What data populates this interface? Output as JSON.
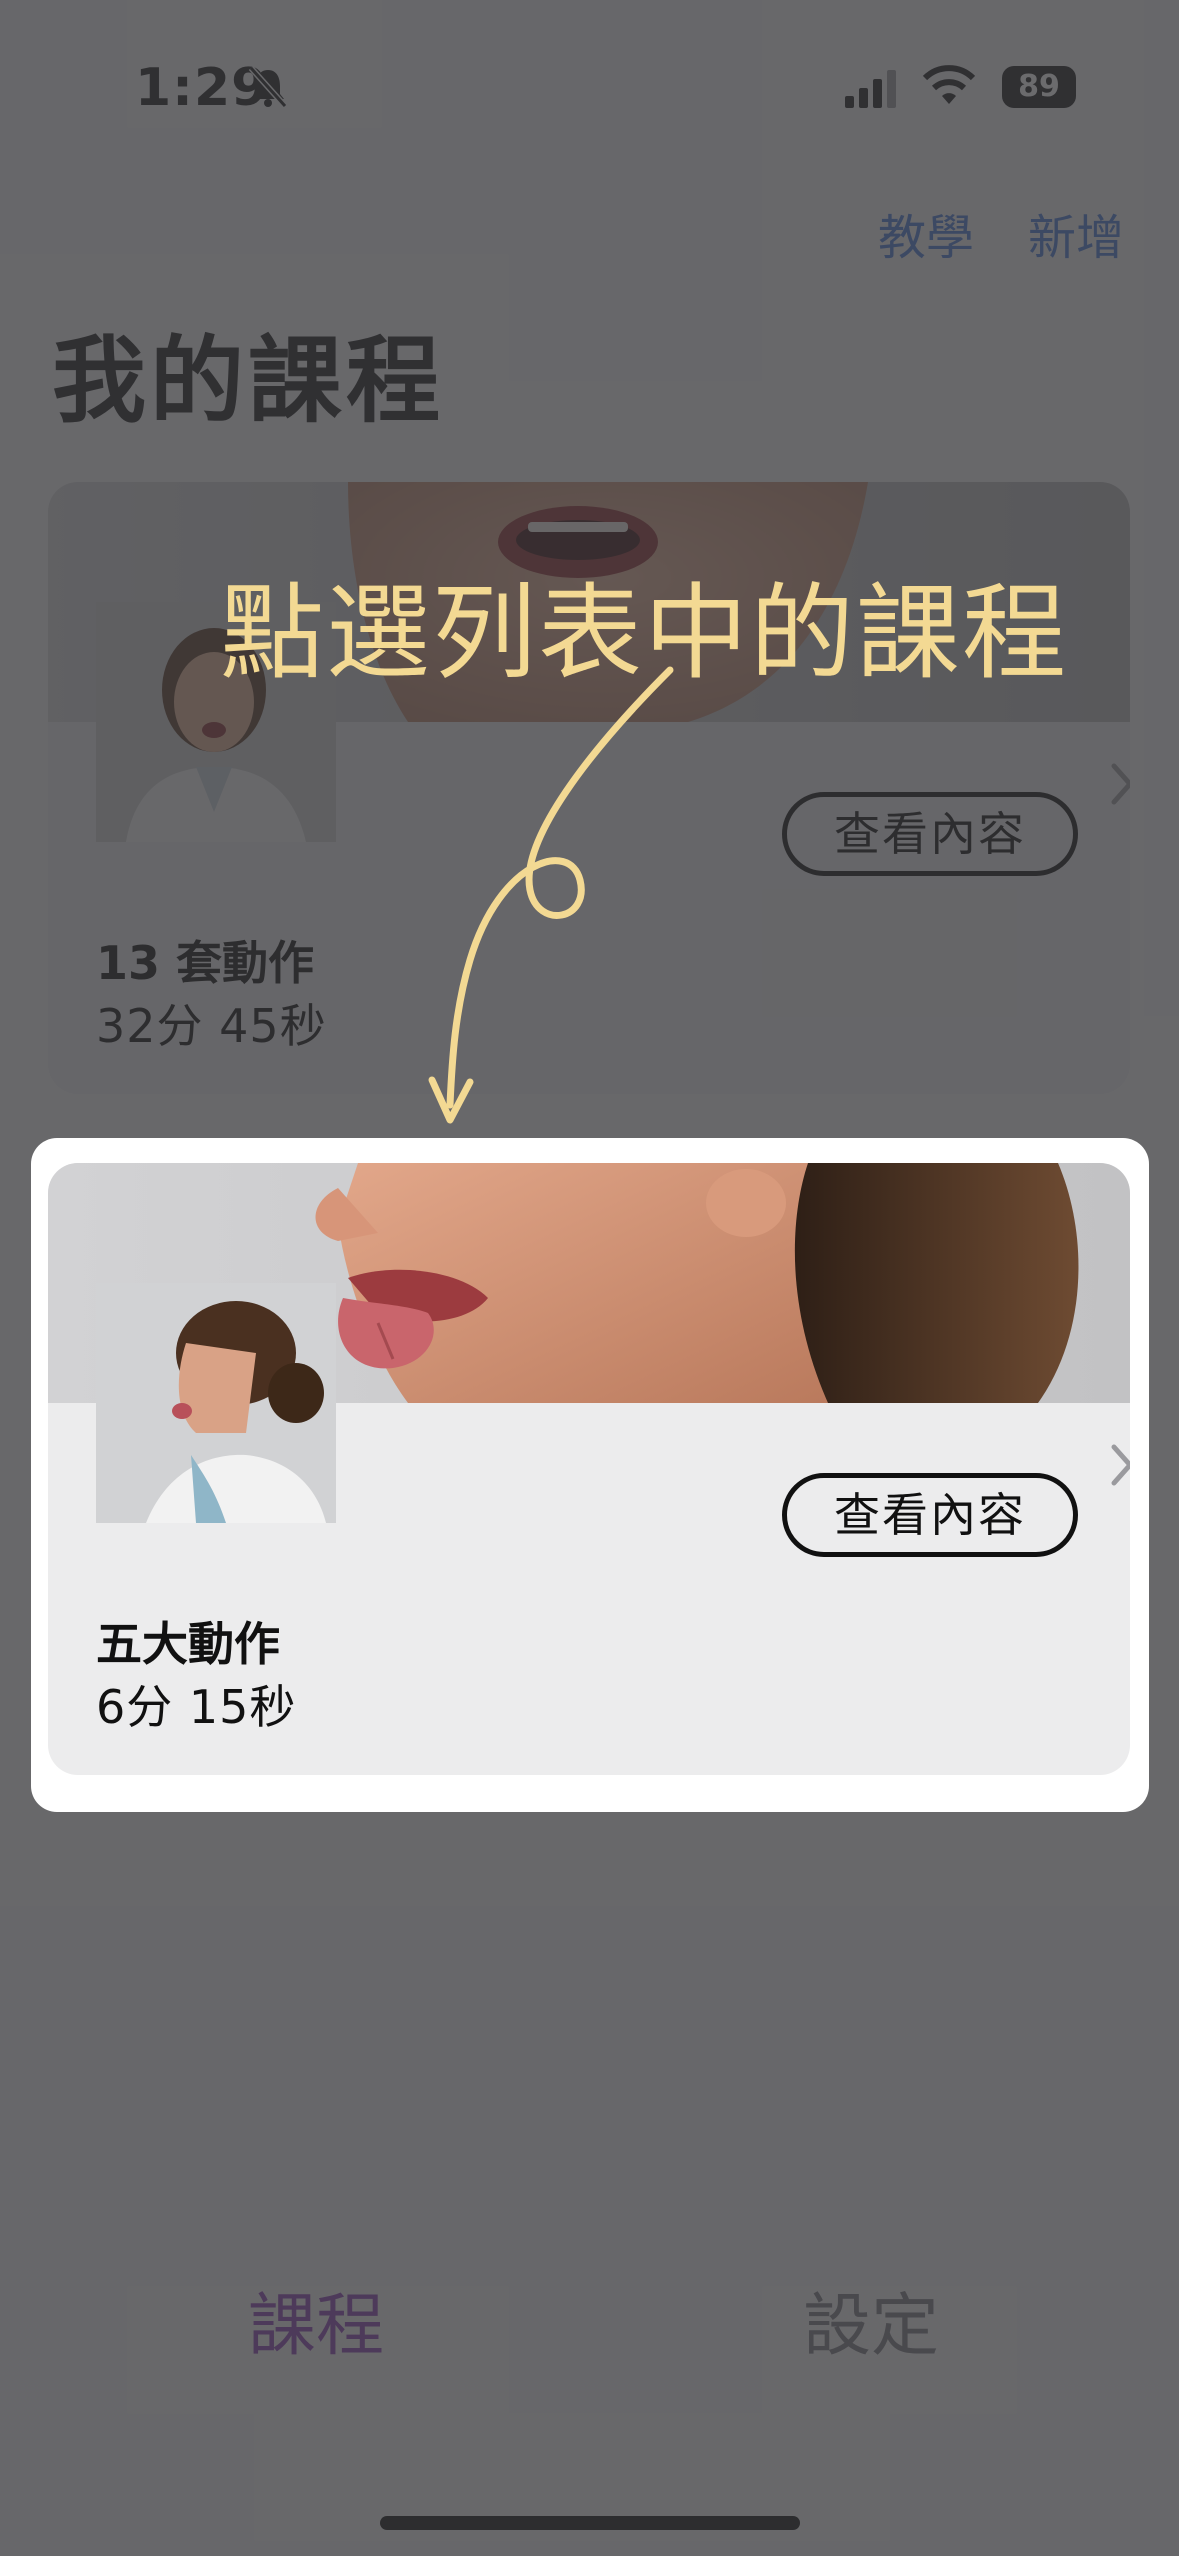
{
  "status_bar": {
    "time": "1:29",
    "battery": "89"
  },
  "nav": {
    "tutorial_label": "教學",
    "add_label": "新增"
  },
  "page_title": "我的課程",
  "courses": [
    {
      "title": "13 套動作",
      "duration": "32分 45秒",
      "button_label": "查看內容"
    },
    {
      "title": "五大動作",
      "duration": "6分 15秒",
      "button_label": "查看內容"
    }
  ],
  "tabs": [
    {
      "label": "課程",
      "active": true
    },
    {
      "label": "設定",
      "active": false
    }
  ],
  "annotation": {
    "text": "點選列表中的課程"
  },
  "colors": {
    "accent_tab": "#8d44b4",
    "nav_link": "#4a7bd8",
    "annotation": "#f3d993"
  }
}
